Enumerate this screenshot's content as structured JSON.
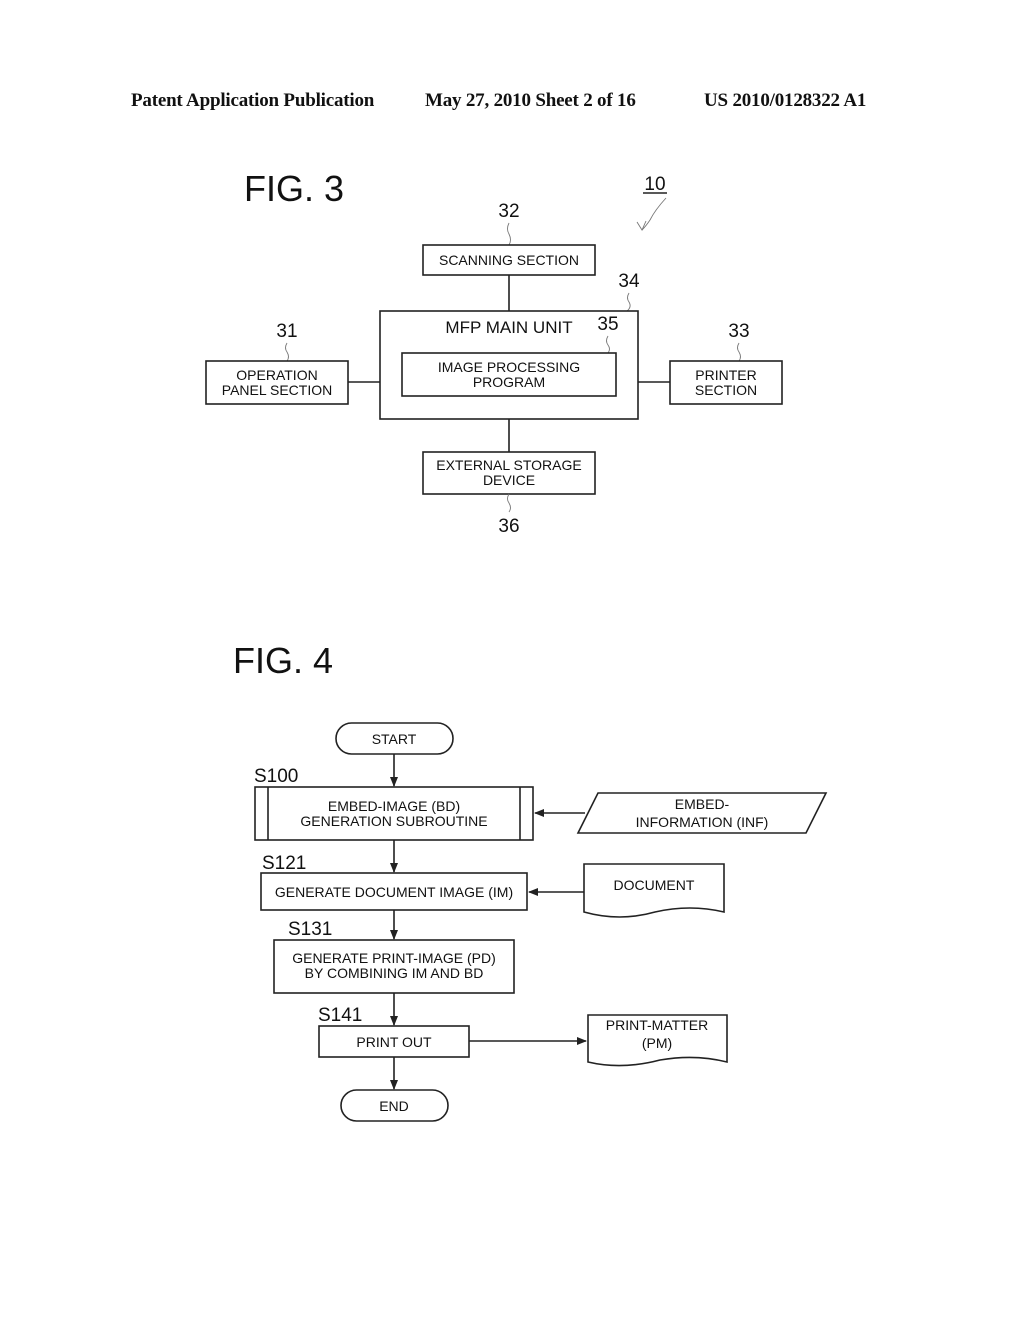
{
  "header": {
    "publication": "Patent Application Publication",
    "date_sheet": "May 27, 2010  Sheet 2 of 16",
    "number": "US 2010/0128322 A1"
  },
  "fig3": {
    "title": "FIG. 3",
    "ref_system": "10",
    "blocks": {
      "scanning": {
        "ref": "32",
        "lines": [
          "SCANNING SECTION"
        ]
      },
      "main_unit": {
        "ref": "34",
        "lines": [
          "MFP MAIN UNIT"
        ]
      },
      "image_program": {
        "ref": "35",
        "lines": [
          "IMAGE PROCESSING",
          "PROGRAM"
        ]
      },
      "operation_panel": {
        "ref": "31",
        "lines": [
          "OPERATION",
          "PANEL SECTION"
        ]
      },
      "printer": {
        "ref": "33",
        "lines": [
          "PRINTER",
          "SECTION"
        ]
      },
      "storage": {
        "ref": "36",
        "lines": [
          "EXTERNAL STORAGE",
          "DEVICE"
        ]
      }
    }
  },
  "fig4": {
    "title": "FIG. 4",
    "start": "START",
    "end": "END",
    "steps": [
      {
        "id": "S100",
        "lines": [
          "EMBED-IMAGE (BD)",
          "GENERATION SUBROUTINE"
        ]
      },
      {
        "id": "S121",
        "lines": [
          "GENERATE DOCUMENT IMAGE (IM)"
        ]
      },
      {
        "id": "S131",
        "lines": [
          "GENERATE PRINT-IMAGE (PD)",
          "BY COMBINING IM AND BD"
        ]
      },
      {
        "id": "S141",
        "lines": [
          "PRINT OUT"
        ]
      }
    ],
    "inputs": {
      "embed_info": [
        "EMBED-",
        "INFORMATION (INF)"
      ],
      "document": [
        "DOCUMENT"
      ],
      "print_matter": [
        "PRINT-MATTER",
        "(PM)"
      ]
    }
  }
}
